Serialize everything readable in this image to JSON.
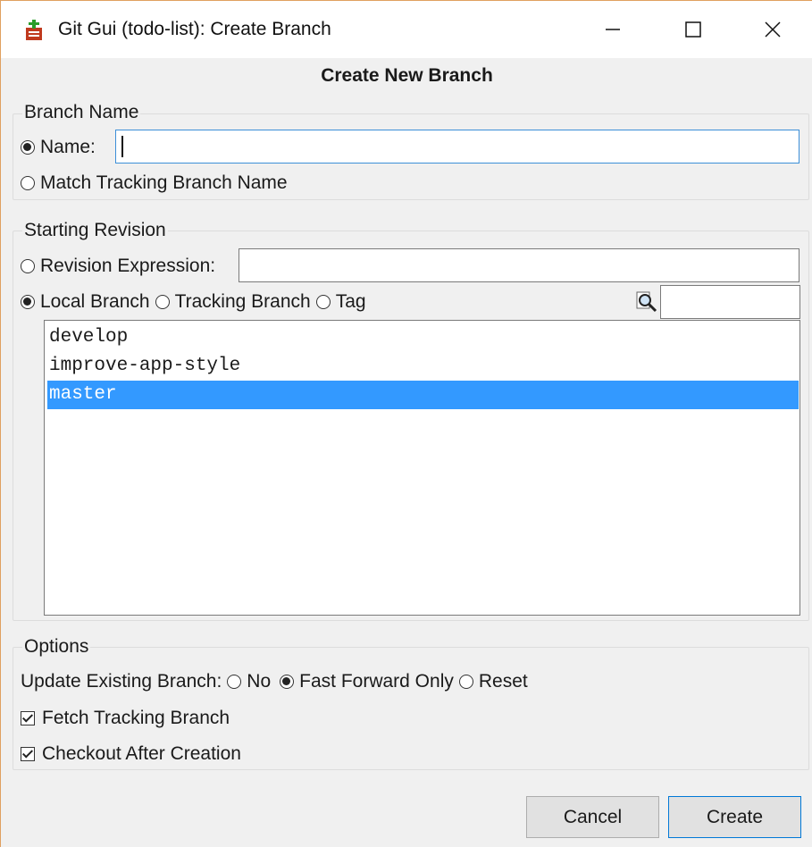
{
  "window": {
    "title": "Git Gui (todo-list): Create Branch",
    "minimize_icon": "minimize-icon",
    "maximize_icon": "maximize-icon",
    "close_icon": "close-icon"
  },
  "heading": "Create New Branch",
  "branch_name": {
    "group_label": "Branch Name",
    "name_label": "Name:",
    "name_value": "",
    "name_selected": true,
    "match_label": "Match Tracking Branch Name",
    "match_selected": false
  },
  "starting_revision": {
    "group_label": "Starting Revision",
    "revision_expression_label": "Revision Expression:",
    "revision_expression_value": "",
    "local_branch_label": "Local Branch",
    "tracking_branch_label": "Tracking Branch",
    "tag_label": "Tag",
    "selected_source": "Local Branch",
    "filter_icon": "search-icon",
    "filter_value": "",
    "branches": [
      "develop",
      "improve-app-style",
      "master"
    ],
    "selected_branch": "master"
  },
  "options": {
    "group_label": "Options",
    "update_label": "Update Existing Branch:",
    "update_no_label": "No",
    "update_ff_label": "Fast Forward Only",
    "update_reset_label": "Reset",
    "update_selected": "Fast Forward Only",
    "fetch_label": "Fetch Tracking Branch",
    "fetch_checked": true,
    "checkout_label": "Checkout After Creation",
    "checkout_checked": true
  },
  "buttons": {
    "cancel": "Cancel",
    "create": "Create"
  },
  "colors": {
    "selection": "#3399ff",
    "default_button_border": "#0078d7"
  }
}
